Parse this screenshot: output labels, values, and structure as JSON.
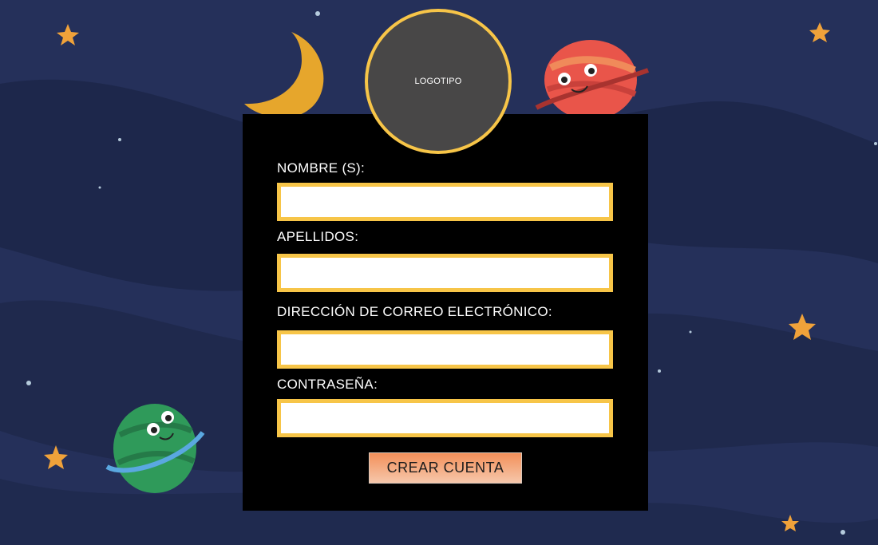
{
  "logo": {
    "text": "LOGOTIPO"
  },
  "form": {
    "fields": [
      {
        "label": "NOMBRE (S):",
        "value": "",
        "placeholder": ""
      },
      {
        "label": "APELLIDOS:",
        "value": "",
        "placeholder": ""
      },
      {
        "label": "DIRECCIÓN DE CORREO ELECTRÓNICO:",
        "value": "",
        "placeholder": ""
      },
      {
        "label": "CONTRASEÑA:",
        "value": "",
        "placeholder": ""
      }
    ],
    "submit_label": "CREAR CUENTA"
  },
  "colors": {
    "background": "#25305a",
    "accent": "#f7c548",
    "card": "#000000",
    "logo_fill": "#484747"
  },
  "decorations": [
    "moon",
    "red-planet",
    "green-planet",
    "stars"
  ]
}
